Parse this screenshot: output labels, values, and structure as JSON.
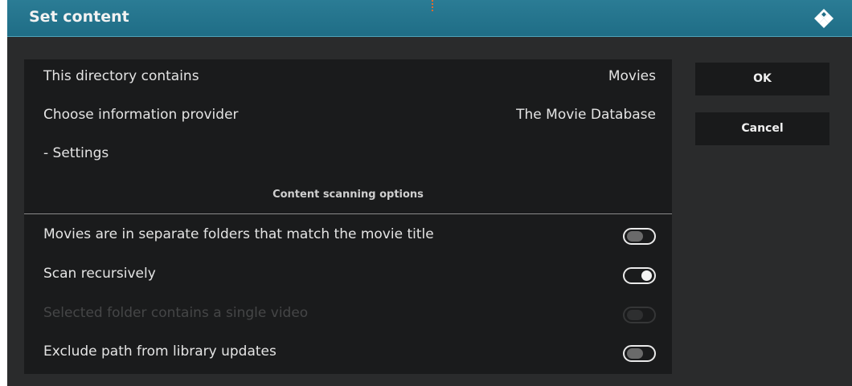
{
  "dialog": {
    "title": "Set content",
    "logo_icon": "kodi-logo-icon"
  },
  "content": {
    "rows": [
      {
        "label": "This directory contains",
        "value": "Movies"
      },
      {
        "label": "Choose information provider",
        "value": "The Movie Database"
      },
      {
        "label": "- Settings",
        "value": ""
      }
    ],
    "section_header": "Content scanning options",
    "options": [
      {
        "label": "Movies are in separate folders that match the movie title",
        "state": "off",
        "enabled": true
      },
      {
        "label": "Scan recursively",
        "state": "on",
        "enabled": true
      },
      {
        "label": "Selected folder contains a single video",
        "state": "off",
        "enabled": false
      },
      {
        "label": "Exclude path from library updates",
        "state": "off",
        "enabled": true
      }
    ]
  },
  "buttons": {
    "ok": "OK",
    "cancel": "Cancel"
  },
  "colors": {
    "title_bar": "#1f6d86",
    "panel_bg": "#1a1b1c",
    "dialog_bg": "#2a2b2c"
  }
}
